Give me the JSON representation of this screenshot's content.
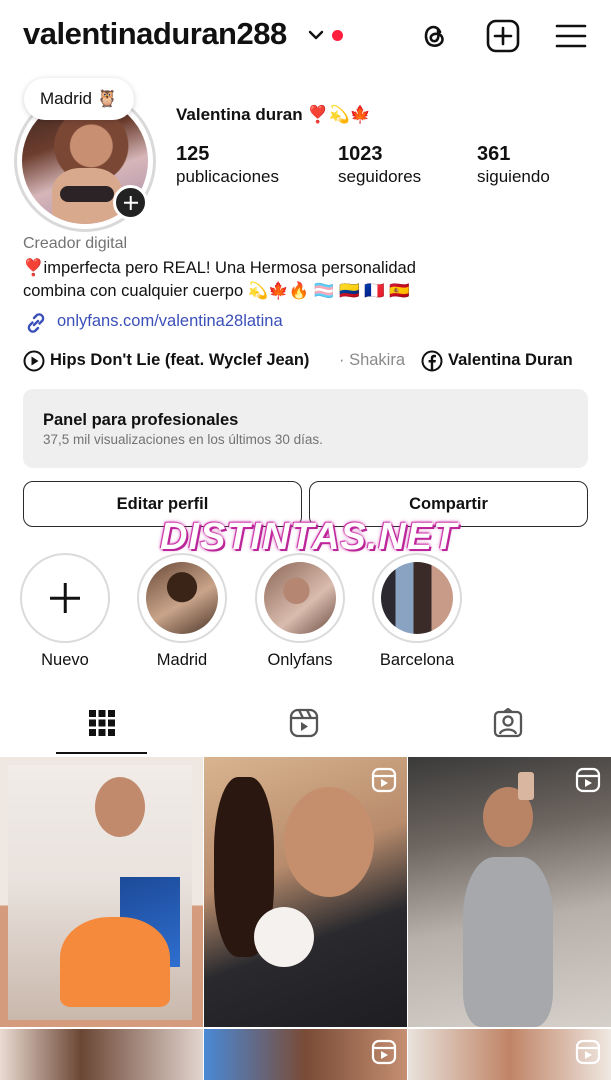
{
  "header": {
    "username": "valentinaduran288"
  },
  "profile": {
    "note": "Madrid 🦉",
    "full_name": "Valentina duran ❣️💫🍁",
    "stats": [
      {
        "value": "125",
        "label": "publicaciones"
      },
      {
        "value": "1023",
        "label": "seguidores"
      },
      {
        "value": "361",
        "label": "siguiendo"
      }
    ],
    "category": "Creador digital",
    "bio_line1": "❣️imperfecta pero REAL! Una Hermosa personalidad",
    "bio_line2": "combina con cualquier cuerpo 💫🍁🔥 🏳️‍⚧️ 🇨🇴 🇫🇷 🇪🇸",
    "link": "onlyfans.com/valentina28latina",
    "music_title": "Hips Don't Lie (feat. Wyclef Jean)",
    "music_artist": "· Shakira",
    "facebook_name": "Valentina Duran"
  },
  "dashboard": {
    "title": "Panel para profesionales",
    "subtitle": "37,5 mil visualizaciones en los últimos 30 días."
  },
  "buttons": {
    "edit": "Editar perfil",
    "share": "Compartir"
  },
  "watermark": "DISTINTAS.NET",
  "highlights": [
    {
      "label": "Nuevo"
    },
    {
      "label": "Madrid"
    },
    {
      "label": "Onlyfans"
    },
    {
      "label": "Barcelona"
    }
  ],
  "tabs": [
    "grid-icon",
    "reels-icon",
    "tagged-icon"
  ],
  "accent_colors": {
    "notification_dot": "#ff1e3c",
    "link": "#3b4fb8",
    "watermark_glow": "#c72ca2"
  }
}
